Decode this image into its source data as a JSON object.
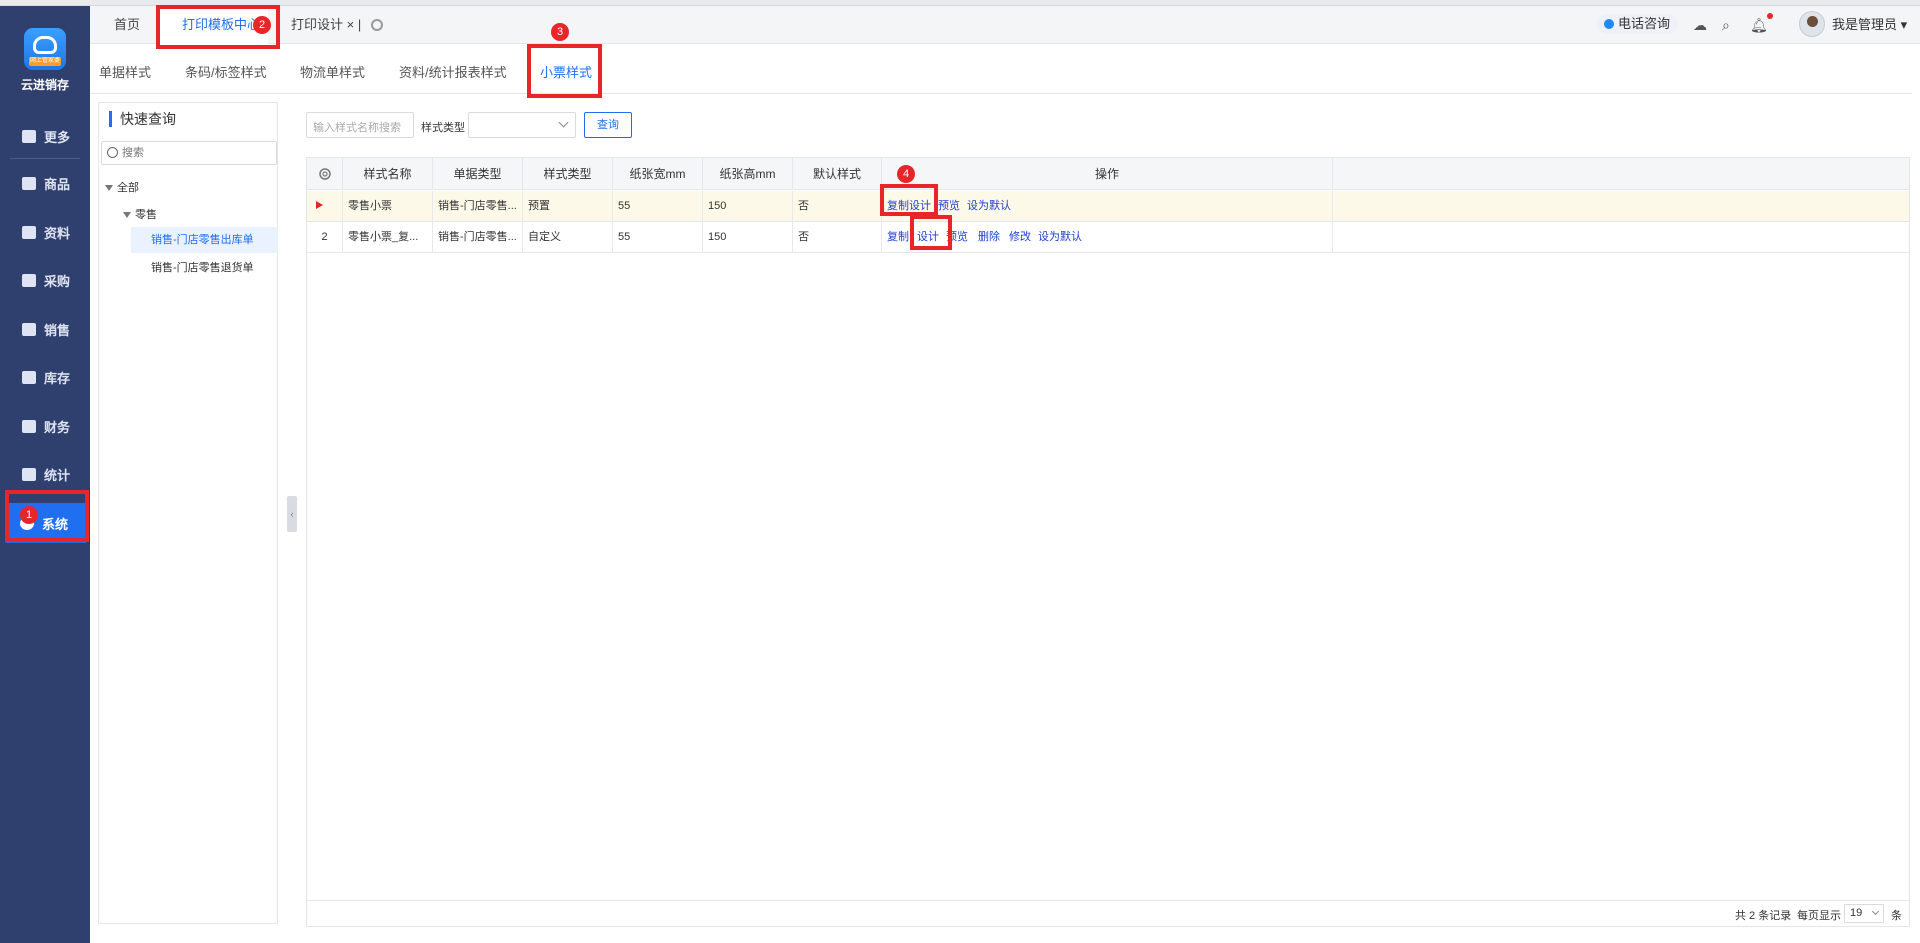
{
  "app": {
    "name": "云进销存",
    "logo_tag": "网上管家婆"
  },
  "sidebar": {
    "items": [
      {
        "label": "更多",
        "icon": "plus-square-icon"
      },
      {
        "label": "商品",
        "icon": "bag-icon"
      },
      {
        "label": "资料",
        "icon": "document-icon"
      },
      {
        "label": "采购",
        "icon": "cart-icon"
      },
      {
        "label": "销售",
        "icon": "bar-chart-icon"
      },
      {
        "label": "库存",
        "icon": "warehouse-icon"
      },
      {
        "label": "财务",
        "icon": "yuan-icon"
      },
      {
        "label": "统计",
        "icon": "stats-icon"
      },
      {
        "label": "系统",
        "icon": "system-icon",
        "active": true
      }
    ]
  },
  "tabs": [
    {
      "label": "首页"
    },
    {
      "label": "打印模板中心",
      "active": true
    },
    {
      "label": "打印设计 ×"
    }
  ],
  "header": {
    "phone_label": "电话咨询",
    "user": "我是管理员"
  },
  "subtabs": [
    "单据样式",
    "条码/标签样式",
    "物流单样式",
    "资料/统计报表样式",
    "小票样式"
  ],
  "subtab_active": "小票样式",
  "tree": {
    "title": "快速查询",
    "search_placeholder": "搜索",
    "nodes": [
      "全部",
      "零售",
      "销售-门店零售出库单",
      "销售-门店零售退货单"
    ],
    "selected": "销售-门店零售出库单"
  },
  "query": {
    "name_placeholder": "输入样式名称搜索",
    "type_label": "样式类型",
    "button": "查询"
  },
  "table": {
    "columns": [
      "样式名称",
      "单据类型",
      "样式类型",
      "纸张宽mm",
      "纸张高mm",
      "默认样式",
      "操作"
    ],
    "rows": [
      {
        "index": "",
        "name": "零售小票",
        "doc_type": "销售-门店零售...",
        "style_type": "预置",
        "width": "55",
        "height": "150",
        "default": "否",
        "actions": [
          "复制设计",
          "预览",
          "设为默认"
        ]
      },
      {
        "index": "2",
        "name": "零售小票_复...",
        "doc_type": "销售-门店零售...",
        "style_type": "自定义",
        "width": "55",
        "height": "150",
        "default": "否",
        "actions": [
          "复制",
          "设计",
          "预览",
          "删除",
          "修改",
          "设为默认"
        ]
      }
    ],
    "footer": {
      "total": "共 2 条记录",
      "per_page_label": "每页显示",
      "per_page": "19",
      "unit": "条"
    }
  },
  "annotations": [
    "1",
    "2",
    "3",
    "4"
  ],
  "colors": {
    "sidebar": "#2f3f6e",
    "accent": "#1f6ff0",
    "highlight": "#e8262a"
  }
}
